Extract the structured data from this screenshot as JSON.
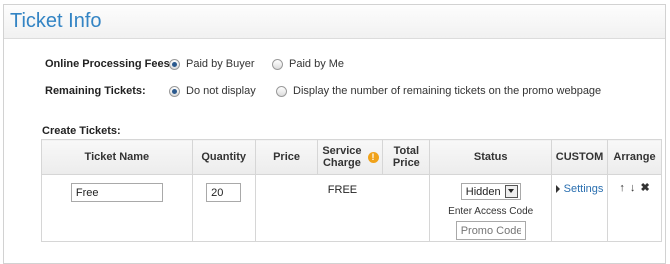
{
  "panel": {
    "title": "Ticket Info"
  },
  "options": {
    "fees": {
      "label": "Online Processing Fees:",
      "choices": [
        {
          "label": "Paid by Buyer",
          "checked": true
        },
        {
          "label": "Paid by Me",
          "checked": false
        }
      ]
    },
    "remaining": {
      "label": "Remaining Tickets:",
      "choices": [
        {
          "label": "Do not display",
          "checked": true
        },
        {
          "label": "Display the number of remaining tickets on the promo webpage",
          "checked": false
        }
      ]
    }
  },
  "create": {
    "label": "Create Tickets:",
    "headers": {
      "name": "Ticket Name",
      "quantity": "Quantity",
      "price": "Price",
      "service_1": "Service",
      "service_2": "Charge",
      "total_1": "Total",
      "total_2": "Price",
      "status": "Status",
      "custom": "CUSTOM",
      "arrange": "Arrange"
    },
    "row": {
      "name": "Free",
      "quantity": "20",
      "price_text": "FREE",
      "status": "Hidden",
      "access_label": "Enter Access Code",
      "access_placeholder": "Promo Code",
      "custom_link": "Settings"
    }
  },
  "icons": {
    "info": "info-icon",
    "up": "arrow-up-icon",
    "down": "arrow-down-icon",
    "delete": "delete-x-icon"
  },
  "colors": {
    "title": "#3384c4",
    "link": "#2a6fb0",
    "info": "#f0a21a"
  }
}
